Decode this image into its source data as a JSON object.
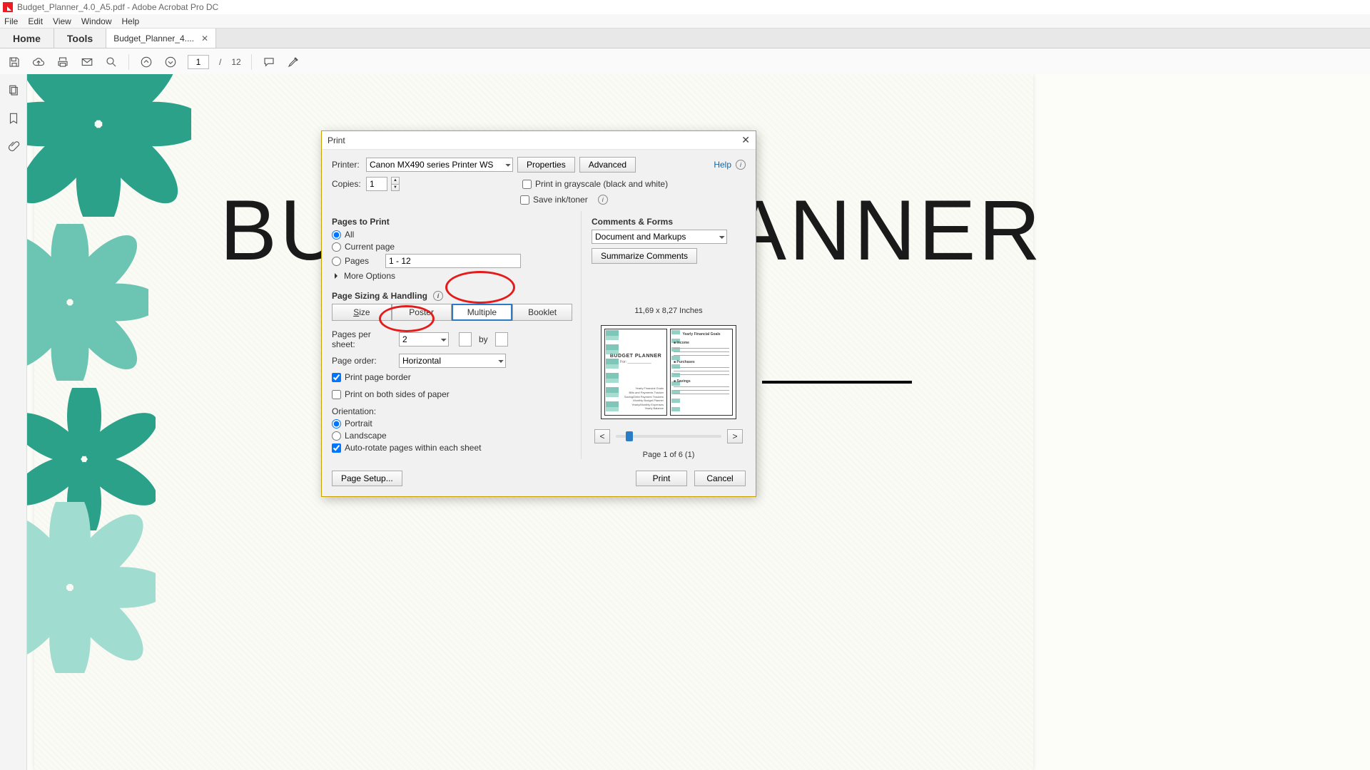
{
  "titlebar": {
    "text": "Budget_Planner_4.0_A5.pdf - Adobe Acrobat Pro DC"
  },
  "menubar": [
    "File",
    "Edit",
    "View",
    "Window",
    "Help"
  ],
  "tabs": {
    "home": "Home",
    "tools": "Tools",
    "doc": "Budget_Planner_4...."
  },
  "toolbar": {
    "page_current": "1",
    "page_sep": "/",
    "page_total": "12"
  },
  "document": {
    "big_title": "BUDGET PLANNER"
  },
  "dialog": {
    "title": "Print",
    "help": "Help",
    "printer_label": "Printer:",
    "printer_value": "Canon MX490 series Printer WS",
    "properties": "Properties",
    "advanced": "Advanced",
    "copies_label": "Copies:",
    "copies_value": "1",
    "grayscale": "Print in grayscale (black and white)",
    "saveink": "Save ink/toner",
    "pages_to_print": "Pages to Print",
    "opt_all": "All",
    "opt_current": "Current page",
    "opt_pages": "Pages",
    "pages_range": "1 - 12",
    "more_options": "More Options",
    "page_sizing": "Page Sizing & Handling",
    "seg_size": "Size",
    "seg_poster": "Poster",
    "seg_multiple": "Multiple",
    "seg_booklet": "Booklet",
    "pps_label": "Pages per sheet:",
    "pps_value": "2",
    "pps_by": "by",
    "page_order_label": "Page order:",
    "page_order_value": "Horizontal",
    "print_border": "Print page border",
    "both_sides": "Print on both sides of paper",
    "orientation": "Orientation:",
    "orient_portrait": "Portrait",
    "orient_landscape": "Landscape",
    "auto_rotate": "Auto-rotate pages within each sheet",
    "comments_forms": "Comments & Forms",
    "comments_value": "Document and Markups",
    "summarize": "Summarize Comments",
    "preview_dims": "11,69 x 8,27 Inches",
    "preview_title": "BUDGET PLANNER",
    "preview_for": "For: ____________",
    "preview_toc": [
      "Yearly Financial Goals",
      "Bills and Payments Tracker",
      "Saving/Debt Payment Trackers",
      "Monthly Budget Planner",
      "Yearly/Monthly Expenses",
      "Yearly Balance"
    ],
    "preview_right_title": "Yearly Financial Goals",
    "preview_income": "Income",
    "preview_purchases": "Purchases",
    "preview_savings": "Savings",
    "page_of": "Page 1 of 6 (1)",
    "page_setup": "Page Setup...",
    "print_btn": "Print",
    "cancel_btn": "Cancel"
  }
}
